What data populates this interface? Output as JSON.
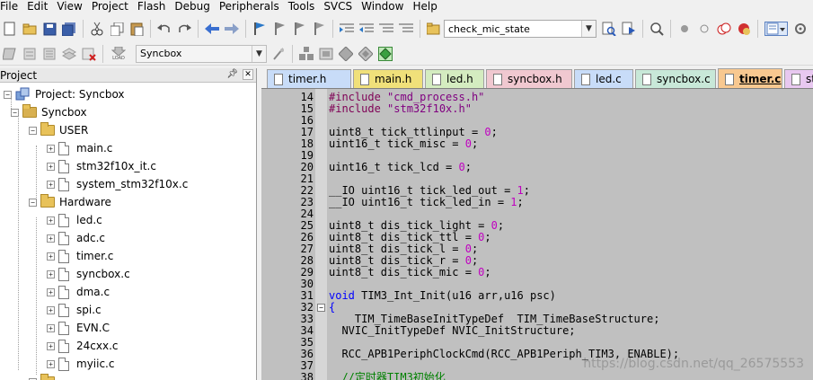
{
  "menu": [
    "File",
    "Edit",
    "View",
    "Project",
    "Flash",
    "Debug",
    "Peripherals",
    "Tools",
    "SVCS",
    "Window",
    "Help"
  ],
  "toolbar": {
    "find_combo_value": "check_mic_state",
    "target_combo_value": "Syncbox",
    "load_label": "LOAD"
  },
  "project": {
    "header": "Project",
    "root": "Project: Syncbox",
    "target": "Syncbox",
    "groups": [
      {
        "name": "USER",
        "files": [
          "main.c",
          "stm32f10x_it.c",
          "system_stm32f10x.c"
        ]
      },
      {
        "name": "Hardware",
        "files": [
          "led.c",
          "adc.c",
          "timer.c",
          "syncbox.c",
          "dma.c",
          "spi.c",
          "EVN.C",
          "24cxx.c",
          "myiic.c"
        ]
      }
    ]
  },
  "tabs": [
    {
      "label": "timer.h",
      "color": "#c8dcf8"
    },
    {
      "label": "main.h",
      "color": "#f0e07a"
    },
    {
      "label": "led.h",
      "color": "#d4ecc0"
    },
    {
      "label": "syncbox.h",
      "color": "#f0c8d0"
    },
    {
      "label": "led.c",
      "color": "#c8dcf8"
    },
    {
      "label": "syncbox.c",
      "color": "#c8e8d8"
    },
    {
      "label": "timer.c",
      "color": "#f8c890",
      "active": true
    },
    {
      "label": "st",
      "color": "#e8c8f0"
    }
  ],
  "editor": {
    "lines": [
      {
        "n": "14",
        "parts": [
          [
            "pp",
            "#include "
          ],
          [
            "str",
            "\"cmd_process.h\""
          ]
        ]
      },
      {
        "n": "15",
        "parts": [
          [
            "pp",
            "#include "
          ],
          [
            "str",
            "\"stm32f10x.h\""
          ]
        ]
      },
      {
        "n": "16",
        "parts": []
      },
      {
        "n": "17",
        "parts": [
          [
            "",
            "uint8_t tick_ttlinput = "
          ],
          [
            "num",
            "0"
          ],
          [
            "",
            ";"
          ]
        ]
      },
      {
        "n": "18",
        "parts": [
          [
            "",
            "uint16_t tick_misc = "
          ],
          [
            "num",
            "0"
          ],
          [
            "",
            ";"
          ]
        ]
      },
      {
        "n": "19",
        "parts": []
      },
      {
        "n": "20",
        "parts": [
          [
            "",
            "uint16_t tick_lcd = "
          ],
          [
            "num",
            "0"
          ],
          [
            "",
            ";"
          ]
        ]
      },
      {
        "n": "21",
        "parts": []
      },
      {
        "n": "22",
        "parts": [
          [
            "",
            "__IO uint16_t tick_led_out = "
          ],
          [
            "num",
            "1"
          ],
          [
            "",
            ";"
          ]
        ]
      },
      {
        "n": "23",
        "parts": [
          [
            "",
            "__IO uint16_t tick_led_in = "
          ],
          [
            "num",
            "1"
          ],
          [
            "",
            ";"
          ]
        ]
      },
      {
        "n": "24",
        "parts": []
      },
      {
        "n": "25",
        "parts": [
          [
            "",
            "uint8_t dis_tick_light = "
          ],
          [
            "num",
            "0"
          ],
          [
            "",
            ";"
          ]
        ]
      },
      {
        "n": "26",
        "parts": [
          [
            "",
            "uint8_t dis_tick_ttl = "
          ],
          [
            "num",
            "0"
          ],
          [
            "",
            ";"
          ]
        ]
      },
      {
        "n": "27",
        "parts": [
          [
            "",
            "uint8_t dis_tick_l = "
          ],
          [
            "num",
            "0"
          ],
          [
            "",
            ";"
          ]
        ]
      },
      {
        "n": "28",
        "parts": [
          [
            "",
            "uint8_t dis_tick_r = "
          ],
          [
            "num",
            "0"
          ],
          [
            "",
            ";"
          ]
        ]
      },
      {
        "n": "29",
        "parts": [
          [
            "",
            "uint8_t dis_tick_mic = "
          ],
          [
            "num",
            "0"
          ],
          [
            "",
            ";"
          ]
        ]
      },
      {
        "n": "30",
        "parts": []
      },
      {
        "n": "31",
        "parts": [
          [
            "kw",
            "void"
          ],
          [
            "",
            " TIM3_Int_Init(u16 arr,u16 psc)"
          ]
        ]
      },
      {
        "n": "32",
        "parts": [
          [
            "kw",
            "{"
          ]
        ],
        "fold": true
      },
      {
        "n": "33",
        "parts": [
          [
            "",
            "    TIM_TimeBaseInitTypeDef  TIM_TimeBaseStructure;"
          ]
        ]
      },
      {
        "n": "34",
        "parts": [
          [
            "",
            "  NVIC_InitTypeDef NVIC_InitStructure;"
          ]
        ]
      },
      {
        "n": "35",
        "parts": []
      },
      {
        "n": "36",
        "parts": [
          [
            "",
            "  RCC_APB1PeriphClockCmd(RCC_APB1Periph_TIM3, ENABLE);"
          ]
        ]
      },
      {
        "n": "37",
        "parts": []
      },
      {
        "n": "38",
        "parts": [
          [
            "cm",
            "  //定时器TIM3初始化"
          ]
        ]
      }
    ]
  },
  "watermark": "https://blog.csdn.net/qq_26575553"
}
